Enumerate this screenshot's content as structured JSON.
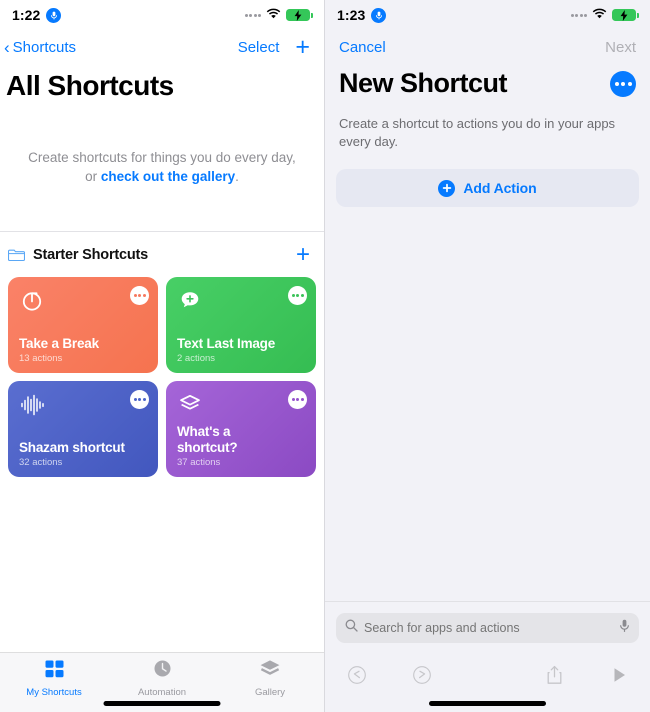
{
  "left": {
    "status": {
      "time": "1:22",
      "mic_icon": "microphone-icon",
      "wifi_icon": "wifi-icon",
      "battery_icon": "battery-charging-icon"
    },
    "nav": {
      "back_label": "Shortcuts",
      "select_label": "Select",
      "add_icon": "plus-icon"
    },
    "page_title": "All Shortcuts",
    "empty_state": {
      "line1": "Create shortcuts for things you do every day,",
      "prefix": "or ",
      "link": "check out the gallery",
      "suffix": "."
    },
    "section": {
      "folder_icon": "folder-icon",
      "title": "Starter Shortcuts",
      "add_icon": "plus-icon"
    },
    "cards": [
      {
        "name": "Take a Break",
        "actions": "13 actions",
        "icon": "timer-icon",
        "color": "#f7795f",
        "color2": "#fa8268",
        "dots": "#f7795f"
      },
      {
        "name": "Text Last Image",
        "actions": "2 actions",
        "icon": "message-plus-icon",
        "color": "#3cc35a",
        "color2": "#44cb62",
        "dots": "#3cc35a"
      },
      {
        "name": "Shazam shortcut",
        "actions": "32 actions",
        "icon": "waveform-icon",
        "color": "#4b63c8",
        "color2": "#5a6ed0",
        "dots": "#4b63c8"
      },
      {
        "name": "What's a\nshortcut?",
        "actions": "37 actions",
        "icon": "layers-icon",
        "color": "#9653cd",
        "color2": "#a061d4",
        "dots": "#9653cd"
      }
    ],
    "tabs": [
      {
        "label": "My Shortcuts",
        "icon": "grid-icon",
        "active": true
      },
      {
        "label": "Automation",
        "icon": "clock-icon",
        "active": false
      },
      {
        "label": "Gallery",
        "icon": "layers-icon",
        "active": false
      }
    ]
  },
  "right": {
    "status": {
      "time": "1:23",
      "mic_icon": "microphone-icon",
      "wifi_icon": "wifi-icon",
      "battery_icon": "battery-charging-icon"
    },
    "nav": {
      "cancel_label": "Cancel",
      "next_label": "Next"
    },
    "page_title": "New Shortcut",
    "more_icon": "ellipsis-icon",
    "description": "Create a shortcut to actions you do in your apps every day.",
    "add_action": {
      "label": "Add Action",
      "icon": "plus-circle-icon"
    },
    "search": {
      "placeholder": "Search for apps and actions",
      "icon": "search-icon",
      "mic_icon": "microphone-icon"
    },
    "toolbar": [
      {
        "name": "undo-button",
        "icon": "undo-icon"
      },
      {
        "name": "redo-button",
        "icon": "redo-icon"
      },
      {
        "name": "share-button",
        "icon": "share-icon"
      },
      {
        "name": "play-button",
        "icon": "play-icon"
      }
    ]
  },
  "colors": {
    "accent": "#067aff",
    "muted": "#8e8e93",
    "card_coral": "#f7795f",
    "card_green": "#3cc35a",
    "card_blue": "#4b63c8",
    "card_purple": "#9653cd"
  }
}
